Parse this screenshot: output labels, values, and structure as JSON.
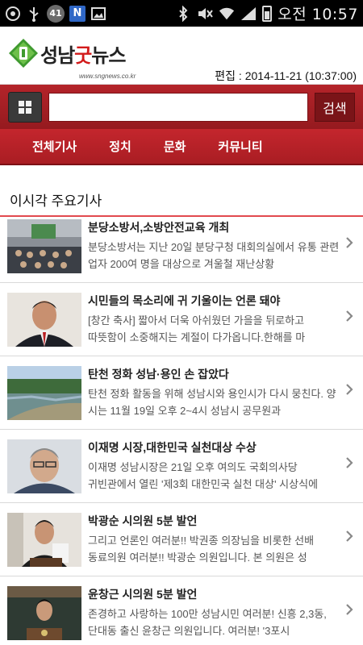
{
  "statusbar": {
    "notif_badge": "41",
    "notif_n": "N",
    "time": "오전 10:57"
  },
  "header": {
    "logo_main": "성남",
    "logo_mark_char": "굿",
    "logo_tail": "뉴스",
    "logo_url": "www.sngnews.co.kr",
    "edit_date": "편집 : 2014-11-21 (10:37:00)"
  },
  "search": {
    "placeholder": "",
    "button_label": "검색"
  },
  "nav": {
    "items": [
      "전체기사",
      "정치",
      "문화",
      "커뮤니티"
    ]
  },
  "section": {
    "title": "이시각 주요기사"
  },
  "articles": [
    {
      "title": "분당소방서,소방안전교육 개최",
      "desc": "분당소방서는 지난 20일 분당구청 대회의실에서 유통 관련 업자 200여 명을 대상으로 겨울철 재난상황"
    },
    {
      "title": "시민들의 목소리에 귀 기울이는 언론 돼야",
      "desc": "[창간 축사] 짧아서 더욱 아쉬웠던 가을을 뒤로하고 따뜻함이 소중해지는 계절이 다가옵니다.한해를 마"
    },
    {
      "title": "탄천 정화 성남·용인 손 잡았다",
      "desc": "탄천 정화 활동을 위해 성남시와 용인시가 다시 뭉친다. 양 시는 11월 19일 오후 2~4시 성남시 공무원과"
    },
    {
      "title": "이재명 시장,대한민국 실천대상 수상",
      "desc": "이재명 성남시장은 21일 오후 여의도 국회의사당 귀빈관에서 열린 '제3회 대한민국 실천 대상' 시상식에"
    },
    {
      "title": "박광순 시의원 5분 발언",
      "desc": "그리고 언론인 여러분!! 박권종 의장님을 비롯한 선배 동료의원 여러분!! 박광순 의원입니다. 본 의원은 성"
    },
    {
      "title": "윤창근 시의원 5분 발언",
      "desc": "존경하고 사랑하는 100만 성남시민 여러분! 신흥 2,3동, 단대동 출신 윤창근 의원입니다. 여러분! '3포시"
    }
  ]
}
